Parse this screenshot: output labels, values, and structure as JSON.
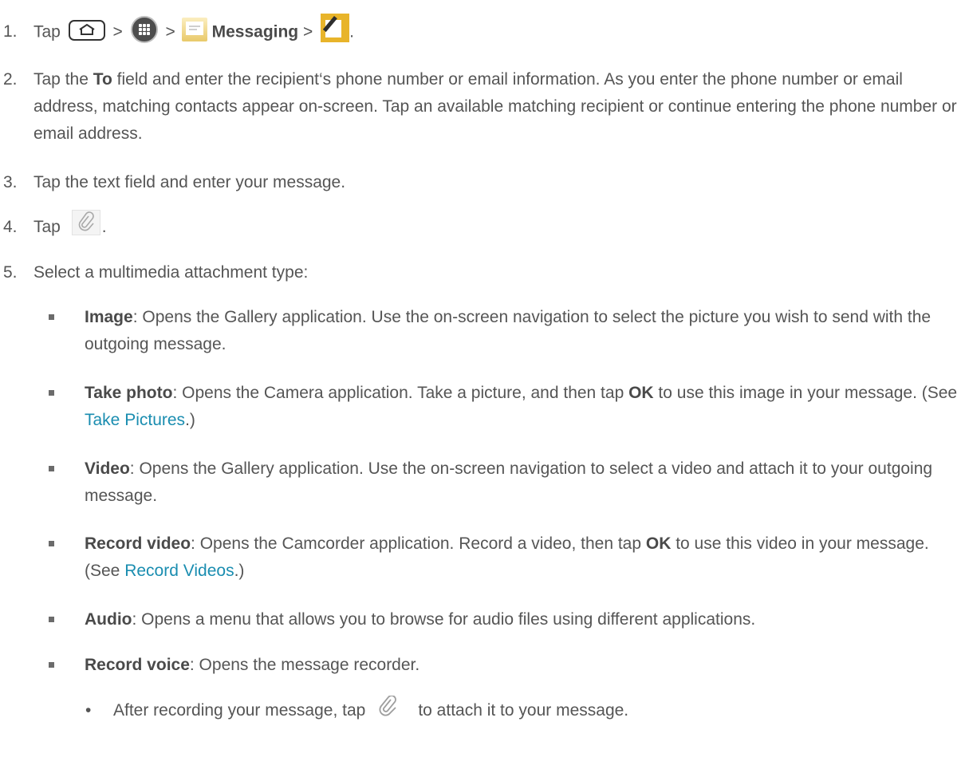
{
  "steps": [
    {
      "num": "1.",
      "tap": "Tap",
      "gt": ">",
      "messaging": "Messaging",
      "end": "."
    },
    {
      "num": "2.",
      "pre": "Tap the ",
      "bold": "To",
      "text": " field and enter the recipient‘s phone number or email information. As you enter the phone number or email address, matching contacts appear on-screen. Tap an available matching recipient or continue entering the phone number or email address."
    },
    {
      "num": "3.",
      "text": "Tap the text field and enter your message."
    },
    {
      "num": "4.",
      "tap": "Tap",
      "end": "."
    },
    {
      "num": "5.",
      "text": "Select a multimedia attachment type:"
    }
  ],
  "bullets": [
    {
      "bold": "Image",
      "text": ": Opens the Gallery application. Use the on-screen navigation to select the picture you wish to send with the outgoing message."
    },
    {
      "bold": "Take photo",
      "text": ": Opens the Camera application. Take a picture, and then tap ",
      "bold2": "OK",
      "text2": " to use this image in your message. (See ",
      "link": "Take Pictures",
      "text3": ".)"
    },
    {
      "bold": "Video",
      "text": ": Opens the Gallery application. Use the on-screen navigation to select a video and attach it to your outgoing message."
    },
    {
      "bold": "Record video",
      "text": ": Opens the Camcorder application. Record a video, then tap ",
      "bold2": "OK",
      "text2": " to use this video in your message. (See ",
      "link": "Record Videos",
      "text3": ".)"
    },
    {
      "bold": "Audio",
      "text": ": Opens a menu that allows you to browse for audio files using different applications."
    },
    {
      "bold": "Record voice",
      "text": ": Opens the message recorder."
    }
  ],
  "sub": {
    "dot": "•",
    "pre": "After recording your message, tap",
    "post": "to attach it to your message."
  },
  "icons": {
    "home": "home-button-icon",
    "apps": "apps-launcher-icon",
    "messaging": "messaging-app-icon",
    "compose": "compose-message-icon",
    "attach": "paperclip-attach-icon"
  }
}
